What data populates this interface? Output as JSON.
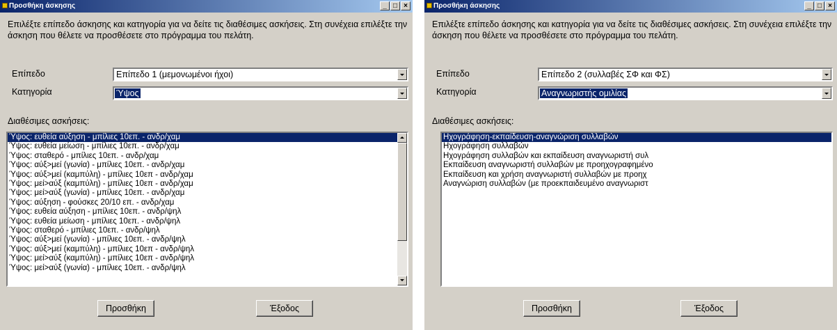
{
  "window_left": {
    "title": "Προσθήκη άσκησης",
    "controls": {
      "minimize": "_",
      "maximize": "□",
      "close": "×"
    },
    "instructions": "Επιλέξτε επίπεδο άσκησης και κατηγορία για να δείτε τις διαθέσιμες ασκήσεις. Στη συνέχεια επιλέξτε την άσκηση που θέλετε να προσθέσετε στο πρόγραμμα του πελάτη.",
    "level_label": "Επίπεδο",
    "level_value": "Επίπεδο 1 (μεμονωμένοι ήχοι)",
    "category_label": "Κατηγορία",
    "category_value": "Ύψος",
    "list_label": "Διαθέσιμες ασκήσεις:",
    "exercises": [
      "Ύψος: ευθεία αύξηση - μπίλιες 10επ. - ανδρ/χαμ",
      "Ύψος: ευθεία μείωση - μπίλιες 10επ. - ανδρ/χαμ",
      "Ύψος: σταθερό -  μπίλιες 10επ. - ανδρ/χαμ",
      "Ύψος: αύξ>μεί (γωνία) -  μπίλιες 10επ. - ανδρ/χαμ",
      "Ύψος: αύξ>μεί (καμπύλη) -  μπίλιες 10επ - ανδρ/χαμ",
      "Ύψος: μεί>αύξ (καμπύλη) -  μπίλιες 10επ - ανδρ/χαμ",
      "Ύψος: μεί>αύξ (γωνία) -  μπίλιες 10επ. - ανδρ/χαμ",
      "Ύψος: αύξηση - φούσκες 20/10 επ. - ανδρ/χαμ",
      "Ύψος: ευθεία αύξηση - μπίλιες 10επ. - ανδρ/ψηλ",
      "Ύψος: ευθεία μείωση - μπίλιες 10επ. - ανδρ/ψηλ",
      "Ύψος: σταθερό -  μπίλιες 10επ. - ανδρ/ψηλ",
      "Ύψος: αύξ>μεί (γωνία) -  μπίλιες 10επ. - ανδρ/ψηλ",
      "Ύψος: αύξ>μεί (καμπύλη) -  μπίλιες 10επ - ανδρ/ψηλ",
      "Ύψος: μεί>αύξ (καμπύλη) -  μπίλιες 10επ - ανδρ/ψηλ",
      "Ύψος: μεί>αύξ (γωνία) -  μπίλιες 10επ. - ανδρ/ψηλ"
    ],
    "add_button": "Προσθήκη",
    "exit_button": "Έξοδος"
  },
  "window_right": {
    "title": "Προσθήκη άσκησης",
    "controls": {
      "minimize": "_",
      "maximize": "□",
      "close": "×"
    },
    "instructions": "Επιλέξτε επίπεδο άσκησης και κατηγορία για να δείτε τις διαθέσιμες ασκήσεις. Στη συνέχεια επιλέξτε την άσκηση που θέλετε να προσθέσετε στο πρόγραμμα του πελάτη.",
    "level_label": "Επίπεδο",
    "level_value": "Επίπεδο 2 (συλλαβές ΣΦ και ΦΣ)",
    "category_label": "Κατηγορία",
    "category_value": "Αναγνωριστής ομιλίας",
    "list_label": "Διαθέσιμες ασκήσεις:",
    "exercises": [
      "Ηχογράφηση-εκπαίδευση-αναγνώριση συλλαβών",
      "Ηχογράφηση συλλαβών",
      "Ηχογράφηση συλλαβών και εκπαίδευση αναγνωριστή συλ",
      "Εκπαίδευση αναγνωριστή συλλαβών με προηχογραφημένο",
      "Εκπαίδευση και χρήση αναγνωριστή συλλαβών με προηχ",
      "Αναγνώριση συλλαβών (με προεκπαιδευμένο αναγνωριστ"
    ],
    "add_button": "Προσθήκη",
    "exit_button": "Έξοδος"
  }
}
